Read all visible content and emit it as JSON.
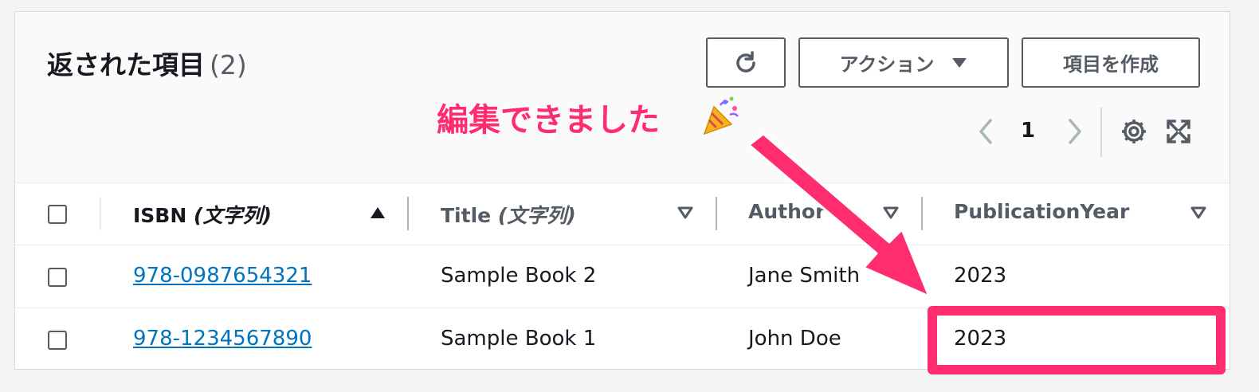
{
  "header": {
    "title": "返された項目",
    "count": "(2)",
    "refresh_icon": "refresh-icon",
    "actions_label": "アクション",
    "create_label": "項目を作成"
  },
  "pagination": {
    "current_page": "1",
    "prev_icon": "chevron-left-icon",
    "next_icon": "chevron-right-icon",
    "settings_icon": "gear-icon",
    "fullscreen_icon": "expand-icon"
  },
  "table": {
    "columns": [
      {
        "name": "ISBN",
        "type": "(文字列)",
        "sort": "ascending"
      },
      {
        "name": "Title",
        "type": "(文字列)",
        "sort": "none"
      },
      {
        "name": "Author",
        "type": "",
        "sort": "none"
      },
      {
        "name": "PublicationYear",
        "type": "",
        "sort": "none"
      }
    ],
    "rows": [
      {
        "isbn": "978-0987654321",
        "title": "Sample Book 2",
        "author": "Jane Smith",
        "year": "2023"
      },
      {
        "isbn": "978-1234567890",
        "title": "Sample Book 1",
        "author": "John Doe",
        "year": "2023"
      }
    ]
  },
  "annotation": {
    "text": "編集できました",
    "emoji_icon": "party-popper-icon",
    "color": "#ff2d6f"
  },
  "colors": {
    "link": "#0073bb",
    "text": "#16191f",
    "muted": "#545b64",
    "accent": "#ff2d6f"
  }
}
